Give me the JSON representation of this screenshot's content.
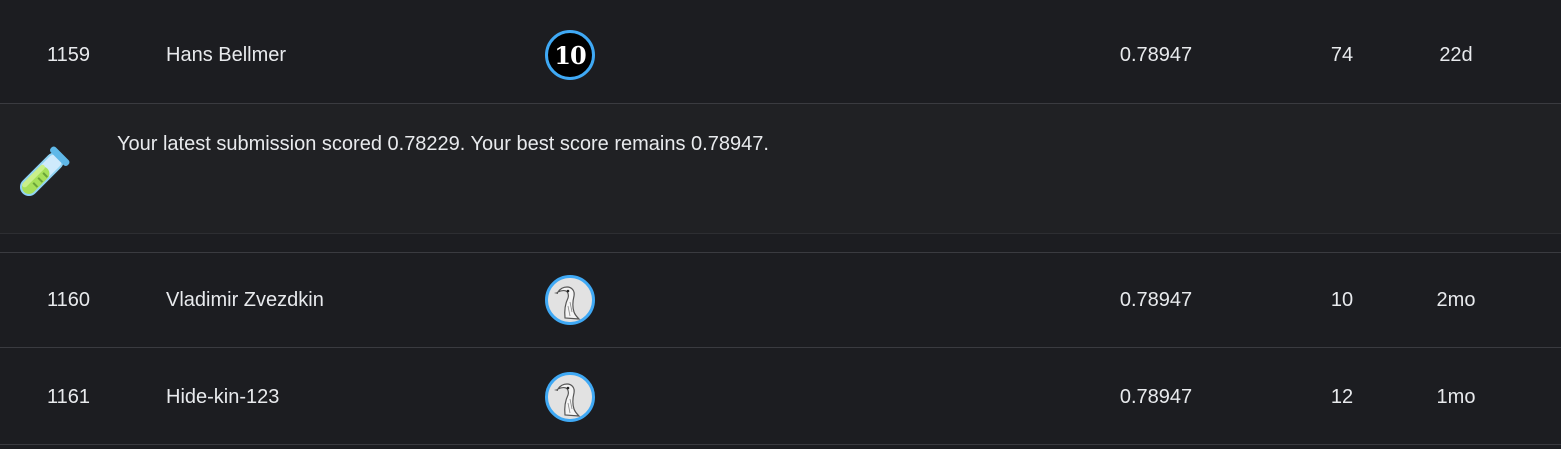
{
  "leaderboard": {
    "rows": [
      {
        "rank": "1159",
        "team_name": "Hans Bellmer",
        "avatar": {
          "kind": "tier-badge",
          "text": "10"
        },
        "score": "0.78947",
        "entries": "74",
        "last": "22d"
      },
      {
        "rank": "1160",
        "team_name": "Vladimir Zvezdkin",
        "avatar": {
          "kind": "goose-icon"
        },
        "score": "0.78947",
        "entries": "10",
        "last": "2mo"
      },
      {
        "rank": "1161",
        "team_name": "Hide-kin-123",
        "avatar": {
          "kind": "goose-icon"
        },
        "score": "0.78947",
        "entries": "12",
        "last": "1mo"
      }
    ],
    "submission_notice": {
      "icon": "test-tube-icon",
      "message": "Your latest submission scored 0.78229. Your best score remains 0.78947."
    }
  },
  "colors": {
    "background": "#1c1d21",
    "banner_background": "#202124",
    "divider": "#3a3b40",
    "avatar_ring": "#3fa9f5",
    "tube_liquid": "#a6e05a",
    "tube_glass": "#8fd3f4"
  }
}
